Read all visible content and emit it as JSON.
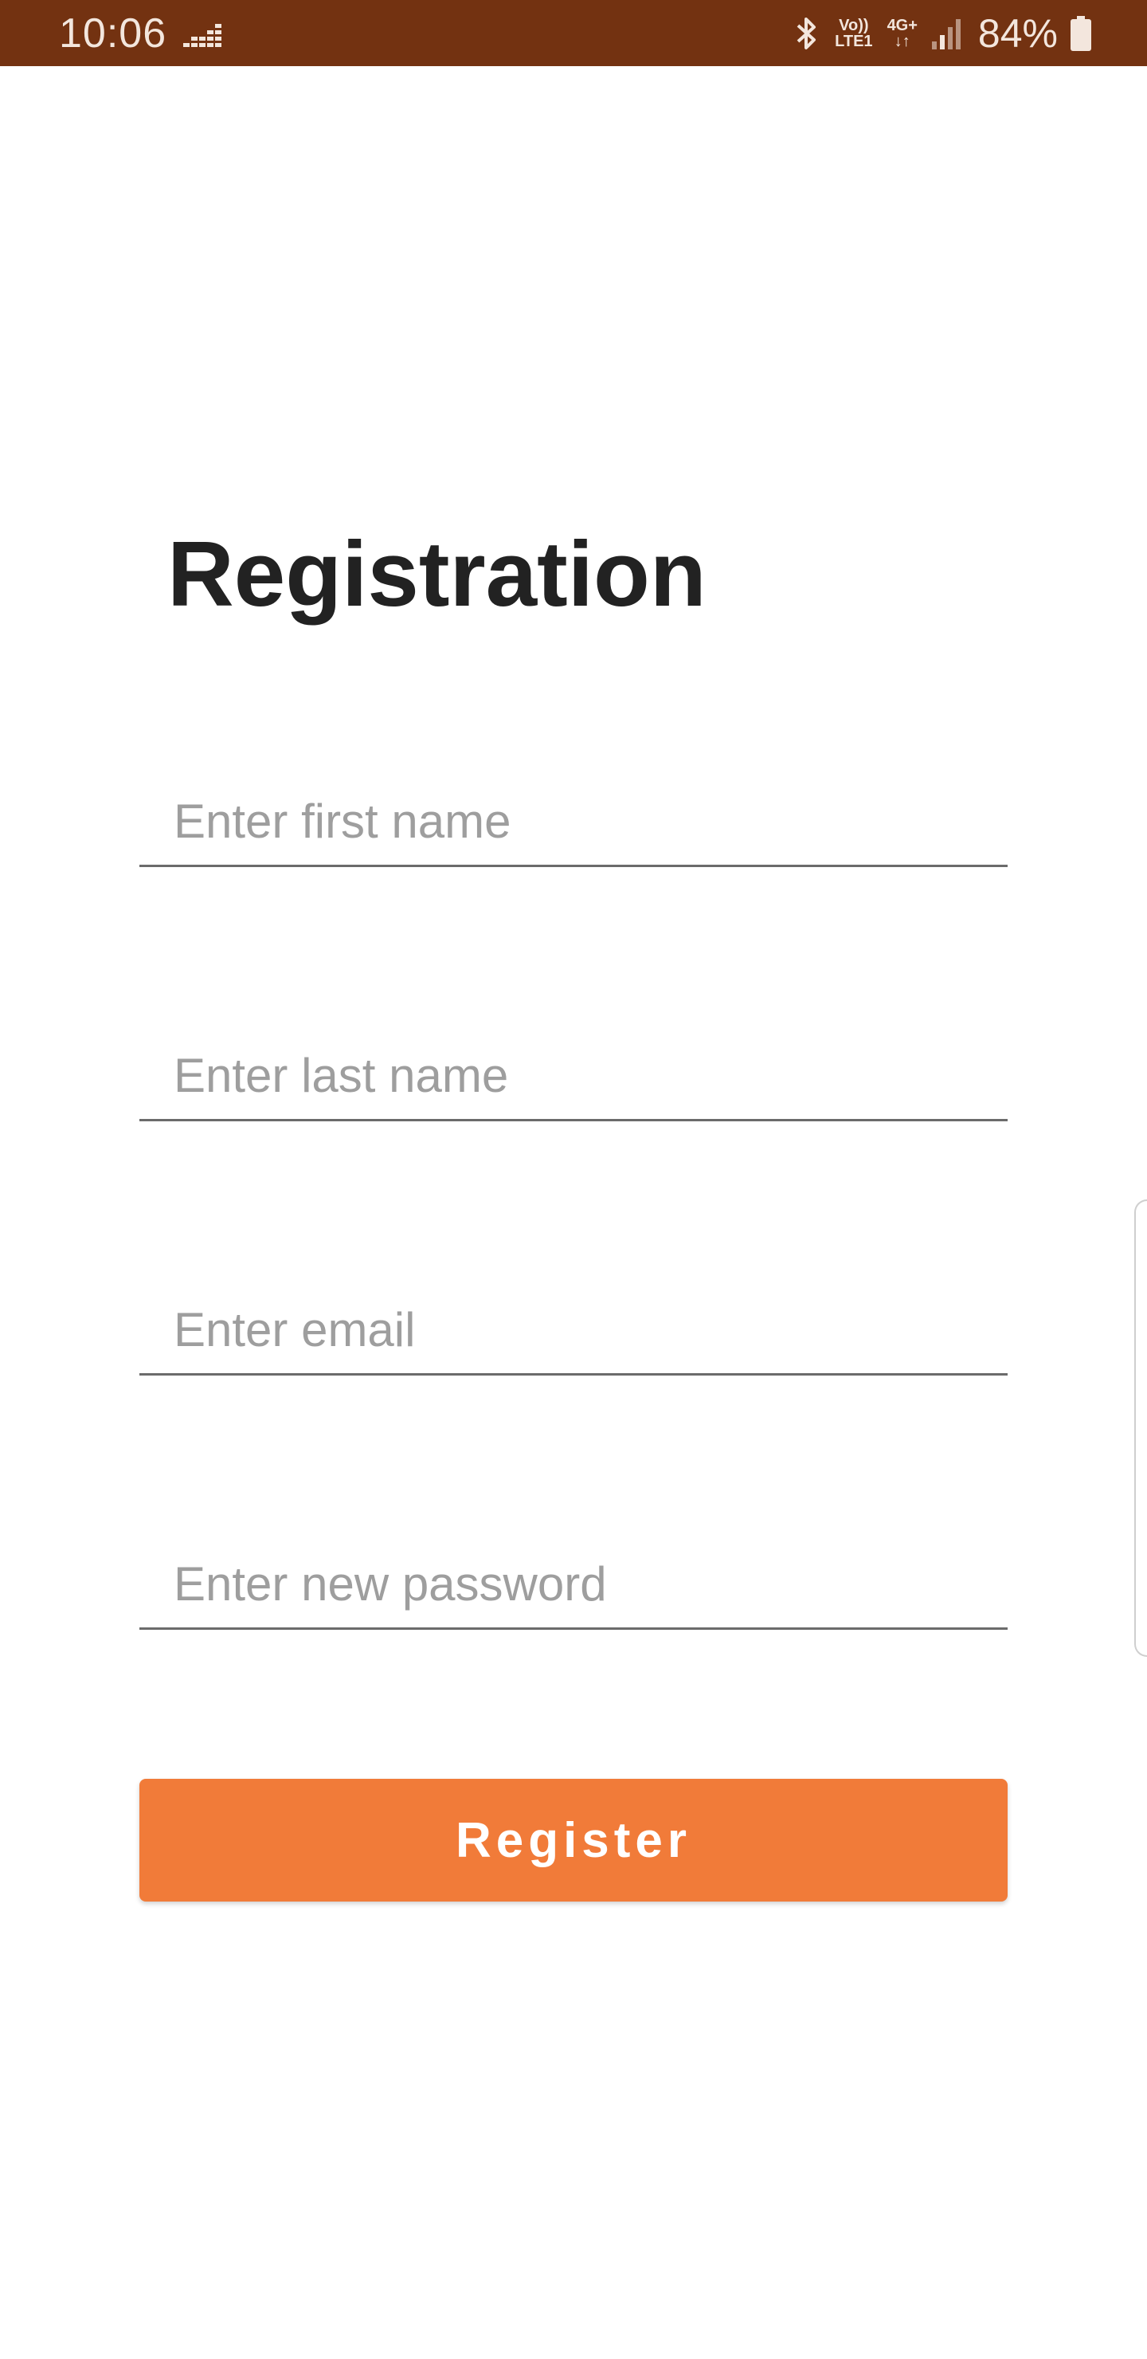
{
  "status_bar": {
    "time": "10:06",
    "volte_top": "Vo))",
    "volte_bottom": "LTE1",
    "network": "4G+",
    "battery_percent": "84%",
    "background_color": "#733211",
    "icons": [
      "notification-bars-icon",
      "bluetooth-icon",
      "volte-icon",
      "data-arrows-icon",
      "signal-icon",
      "battery-icon"
    ]
  },
  "form": {
    "title": "Registration",
    "fields": [
      {
        "placeholder": "Enter first name",
        "value": ""
      },
      {
        "placeholder": "Enter last name",
        "value": ""
      },
      {
        "placeholder": "Enter email",
        "value": ""
      },
      {
        "placeholder": "Enter new password",
        "value": ""
      }
    ],
    "submit_label": "Register",
    "accent_color": "#f17b39"
  }
}
